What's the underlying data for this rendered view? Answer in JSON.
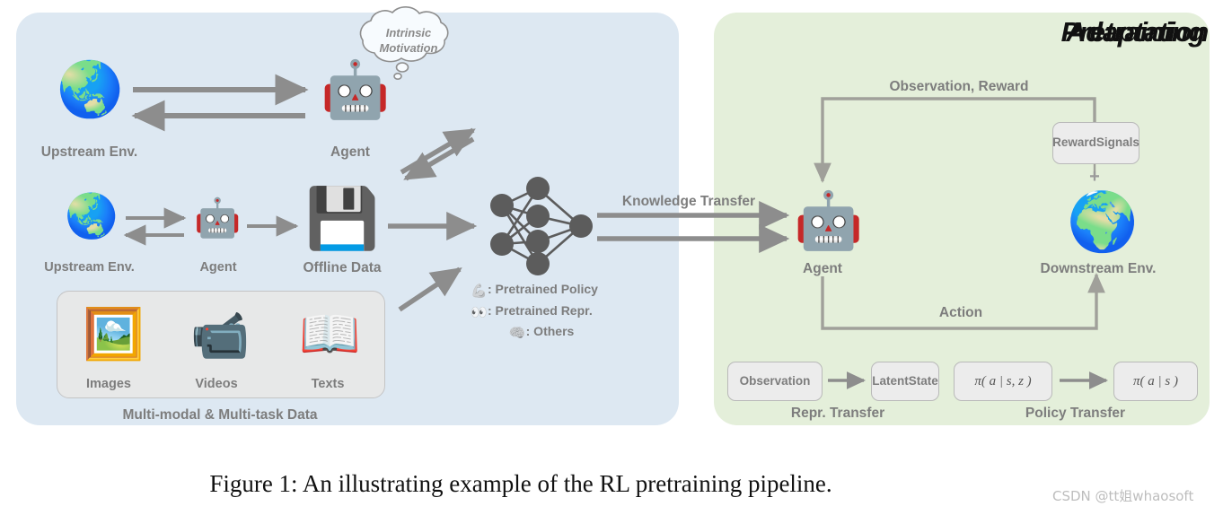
{
  "figure": {
    "caption": "Figure 1: An illustrating example of the RL pretraining pipeline.",
    "watermark": "CSDN @tt姐whaosoft"
  },
  "colors": {
    "pretraining_panel": "#dde8f2",
    "adaptation_panel": "#e4efda",
    "arrow_gray": "#8d8d8d",
    "label_gray": "#7d7d7d",
    "node_gray": "#5c5c5c",
    "box_fill": "#ececec",
    "box_border": "#b9b9b9"
  },
  "pretraining": {
    "title": "Pretraining",
    "thought_bubble": {
      "line1": "Intrinsic",
      "line2": "Motivation",
      "icon": "thought-cloud-icon"
    },
    "row_online": {
      "env_label": "Upstream Env.",
      "env_icon": "globe-icon",
      "agent_label": "Agent",
      "agent_icon": "robot-icon"
    },
    "row_offline": {
      "env_label": "Upstream Env.",
      "env_icon": "globe-icon",
      "agent_label": "Agent",
      "agent_icon": "robot-icon",
      "data_label": "Offline Data",
      "data_icon": "floppy-disk-icon"
    },
    "data_container": {
      "caption": "Multi-modal & Multi-task Data",
      "items": [
        {
          "label": "Images",
          "icon": "framed-picture-icon"
        },
        {
          "label": "Videos",
          "icon": "video-camera-icon"
        },
        {
          "label": "Texts",
          "icon": "open-book-icon"
        }
      ]
    },
    "network": {
      "icon": "neural-network-icon",
      "layers": [
        2,
        4,
        1
      ]
    },
    "legend": [
      {
        "icon": "flexed-biceps-icon",
        "label": ": Pretrained Policy",
        "glyph": "💪"
      },
      {
        "icon": "eyes-icon",
        "label": ": Pretrained Repr.",
        "glyph": "👀"
      },
      {
        "icon": "brain-icon",
        "label": ": Others",
        "glyph": "🧠"
      }
    ]
  },
  "transfer": {
    "label": "Knowledge Transfer",
    "arrow_count": 2
  },
  "adaptation": {
    "title": "Adaptation",
    "agent_label": "Agent",
    "agent_icon": "robot-icon",
    "env_label": "Downstream Env.",
    "env_icon": "globe-icon",
    "observation_reward_label": "Observation, Reward",
    "action_label": "Action",
    "reward_signals_box": "Reward Signals",
    "reward_signals_line1": "Reward",
    "reward_signals_line2": "Signals",
    "plus_sign": "+",
    "repr_transfer": {
      "caption": "Repr. Transfer",
      "from_box": "Observation",
      "to_box_line1": "Latent",
      "to_box_line2": "State"
    },
    "policy_transfer": {
      "caption": "Policy Transfer",
      "from_box": "π( a | s, z )",
      "to_box": "π( a | s )"
    }
  }
}
